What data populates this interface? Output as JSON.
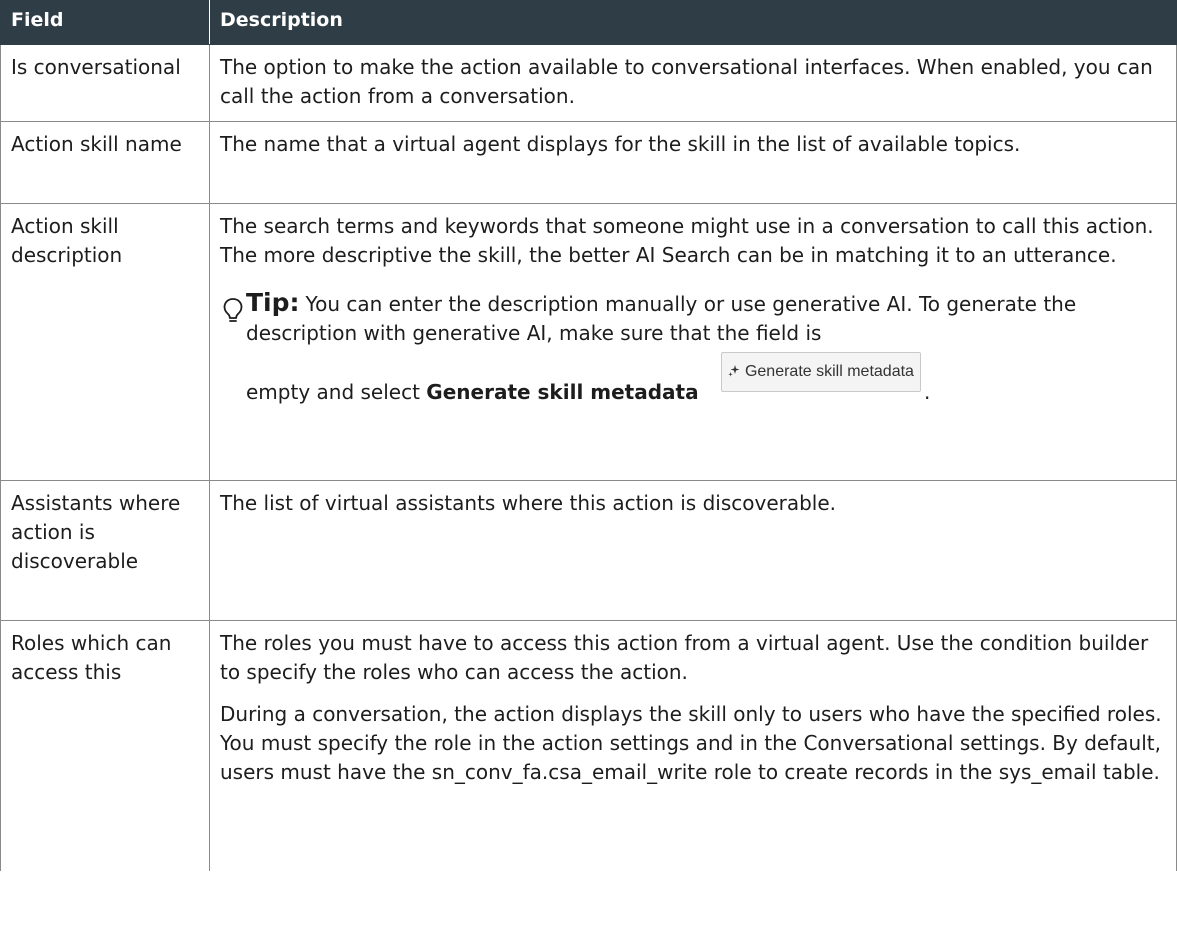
{
  "table": {
    "headers": [
      "Field",
      "Description"
    ],
    "rows": [
      {
        "field": "Is conversational",
        "paragraphs": [
          "The option to make the action available to conversational interfaces. When enabled, you can call the action from a conversation."
        ]
      },
      {
        "field": "Action skill name",
        "paragraphs": [
          "The name that a virtual agent displays for the skill in the list of available topics."
        ]
      },
      {
        "field": "Action skill description",
        "paragraphs": [
          "The search terms and keywords that someone might use in a conversation to call this action. The more descriptive the skill, the better AI Search can be in matching it to an utterance."
        ],
        "tip": {
          "label": "Tip:",
          "text": "You can enter the description manually or use generative AI. To generate the description with generative AI, make sure that the field is",
          "text_end": "empty and select",
          "keyword": "Generate skill metadata",
          "button_label": "Generate skill metadata",
          "period": "."
        }
      },
      {
        "field": "Assistants where action is discoverable",
        "paragraphs": [
          "The list of virtual assistants where this action is discoverable."
        ]
      },
      {
        "field": "Roles which can access this",
        "paragraphs": [
          "The roles you must have to access this action from a virtual agent. Use the condition builder to specify the roles who can access the action.",
          "During a conversation, the action displays the skill only to users who have the specified roles. You must specify the role in the action settings and in the Conversational settings. By default, users must have the sn_conv_fa.csa_email_write role to create records in the sys_email table."
        ]
      }
    ]
  },
  "icons": {
    "tip": "lightbulb-icon",
    "button": "sparkle-icon"
  },
  "colors": {
    "header_bg": "#2f3d47",
    "header_text": "#ffffff",
    "border": "#8a8a8a"
  }
}
